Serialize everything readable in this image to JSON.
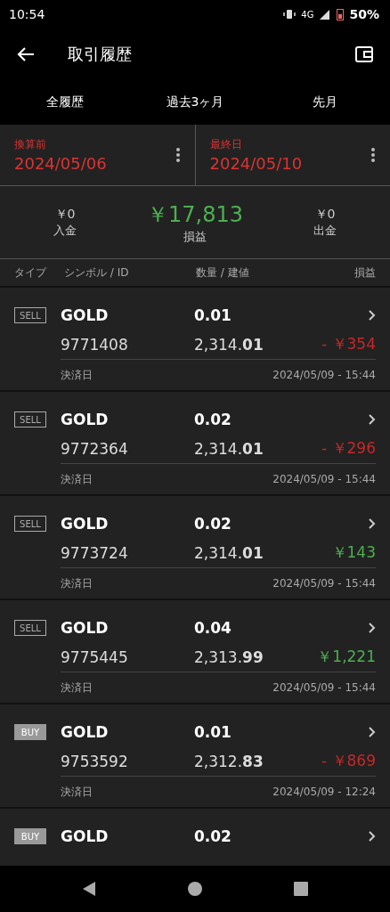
{
  "status_bar": {
    "time": "10:54",
    "network": "4G",
    "battery": "50%"
  },
  "header": {
    "title": "取引履歴"
  },
  "tabs": [
    "全履歴",
    "過去3ヶ月",
    "先月"
  ],
  "date_filters": [
    {
      "label": "換算前",
      "value": "2024/05/06"
    },
    {
      "label": "最終日",
      "value": "2024/05/10"
    }
  ],
  "summary": [
    {
      "value": "￥0",
      "label": "入金",
      "kind": "side"
    },
    {
      "value": "￥17,813",
      "label": "損益",
      "kind": "main"
    },
    {
      "value": "￥0",
      "label": "出金",
      "kind": "side"
    }
  ],
  "columns": [
    "タイプ",
    "シンボル / ID",
    "数量 / 建値",
    "損益"
  ],
  "trades": [
    {
      "type": "SELL",
      "kind": "sell",
      "symbol": "GOLD",
      "volume": "0.01",
      "id": "9771408",
      "price": "2,314.**01**",
      "profit": "- ￥354",
      "loss": true,
      "close_label": "決済日",
      "close_time": "2024/05/09 - 15:44"
    },
    {
      "type": "SELL",
      "kind": "sell",
      "symbol": "GOLD",
      "volume": "0.02",
      "id": "9772364",
      "price": "2,314.**01**",
      "profit": "- ￥296",
      "loss": true,
      "close_label": "決済日",
      "close_time": "2024/05/09 - 15:44"
    },
    {
      "type": "SELL",
      "kind": "sell",
      "symbol": "GOLD",
      "volume": "0.02",
      "id": "9773724",
      "price": "2,314.**01**",
      "profit": "￥143",
      "loss": false,
      "close_label": "決済日",
      "close_time": "2024/05/09 - 15:44"
    },
    {
      "type": "SELL",
      "kind": "sell",
      "symbol": "GOLD",
      "volume": "0.04",
      "id": "9775445",
      "price": "2,313.**99**",
      "profit": "￥1,221",
      "loss": false,
      "close_label": "決済日",
      "close_time": "2024/05/09 - 15:44"
    },
    {
      "type": "BUY",
      "kind": "buy",
      "symbol": "GOLD",
      "volume": "0.01",
      "id": "9753592",
      "price": "2,312.**83**",
      "profit": "- ￥869",
      "loss": true,
      "close_label": "決済日",
      "close_time": "2024/05/09 - 12:24"
    },
    {
      "type": "BUY",
      "kind": "buy",
      "symbol": "GOLD",
      "volume": "0.02"
    }
  ]
}
